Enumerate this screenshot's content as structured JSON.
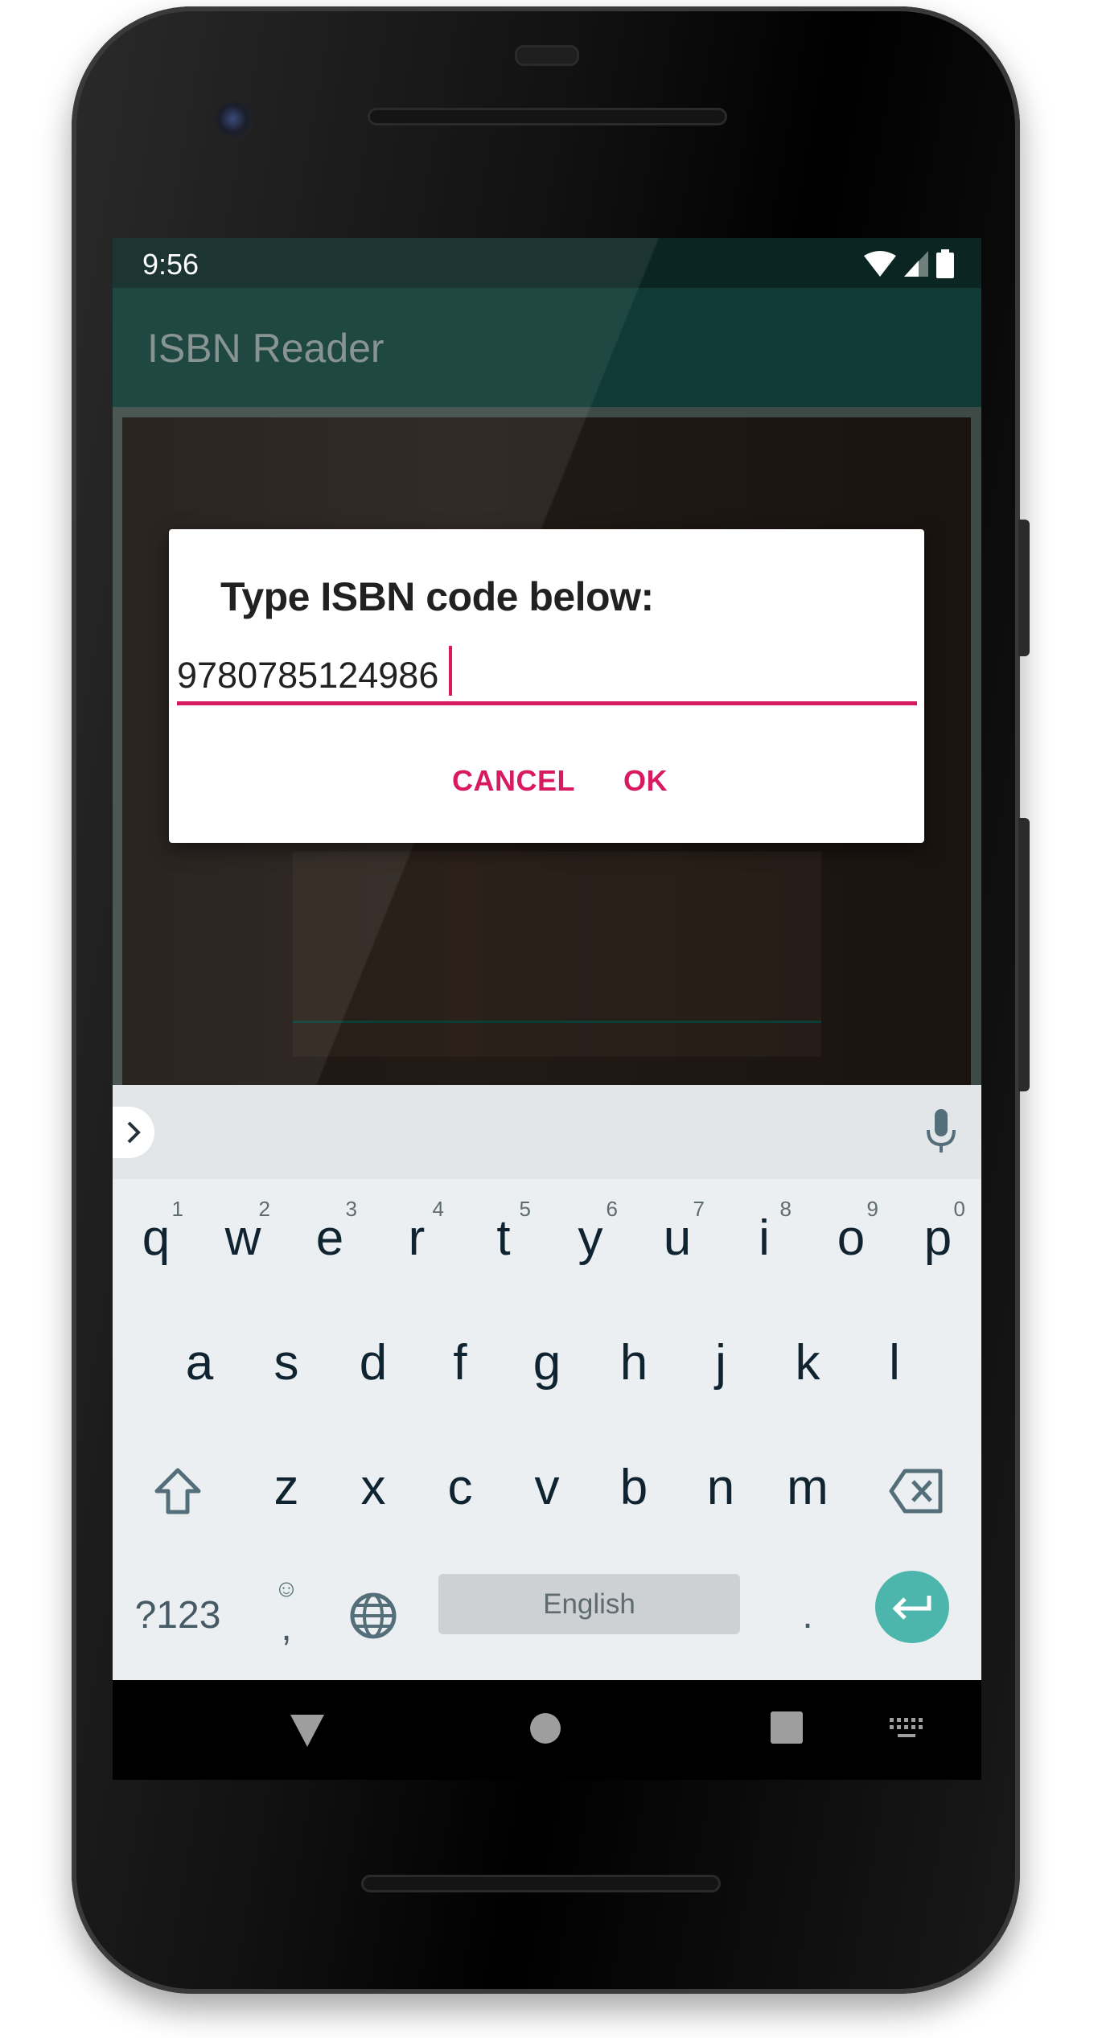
{
  "status_bar": {
    "time": "9:56",
    "icons": [
      "wifi-icon",
      "signal-icon",
      "battery-icon"
    ]
  },
  "app_bar": {
    "title": "ISBN Reader"
  },
  "dialog": {
    "title": "Type ISBN code below:",
    "input_value": "9780785124986",
    "cancel_label": "CANCEL",
    "ok_label": "OK"
  },
  "keyboard": {
    "row1": [
      {
        "k": "q",
        "h": "1"
      },
      {
        "k": "w",
        "h": "2"
      },
      {
        "k": "e",
        "h": "3"
      },
      {
        "k": "r",
        "h": "4"
      },
      {
        "k": "t",
        "h": "5"
      },
      {
        "k": "y",
        "h": "6"
      },
      {
        "k": "u",
        "h": "7"
      },
      {
        "k": "i",
        "h": "8"
      },
      {
        "k": "o",
        "h": "9"
      },
      {
        "k": "p",
        "h": "0"
      }
    ],
    "row2": [
      "a",
      "s",
      "d",
      "f",
      "g",
      "h",
      "j",
      "k",
      "l"
    ],
    "row3": [
      "z",
      "x",
      "c",
      "v",
      "b",
      "n",
      "m"
    ],
    "symbols_label": "?123",
    "comma_label": ",",
    "space_label": "English",
    "period_label": "."
  },
  "colors": {
    "accent": "#d81b60",
    "app_bar": "#0f3a35",
    "enter_key": "#4db6ac"
  }
}
